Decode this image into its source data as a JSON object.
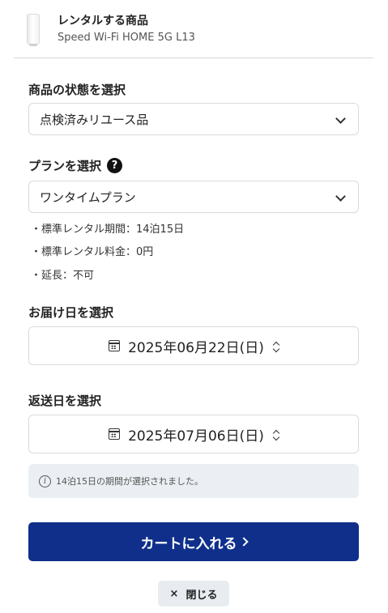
{
  "product": {
    "heading": "レンタルする商品",
    "name": "Speed Wi-Fi HOME 5G L13"
  },
  "condition": {
    "label": "商品の状態を選択",
    "selected": "点検済みリユース品"
  },
  "plan": {
    "label": "プランを選択",
    "help_icon": "?",
    "selected": "ワンタイムプラン",
    "details": [
      "・標準レンタル期間：14泊15日",
      "・標準レンタル料金：0円",
      "・延長：不可"
    ]
  },
  "delivery": {
    "label": "お届け日を選択",
    "date": "2025年06月22日(日)"
  },
  "return": {
    "label": "返送日を選択",
    "date": "2025年07月06日(日)"
  },
  "notice": {
    "icon": "i",
    "text": "14泊15日の期間が選択されました。"
  },
  "actions": {
    "cart_label": "カートに入れる",
    "close_icon": "×",
    "close_label": "閉じる"
  },
  "colors": {
    "primary": "#0f2f8b",
    "notice_bg": "#ebeff3"
  }
}
